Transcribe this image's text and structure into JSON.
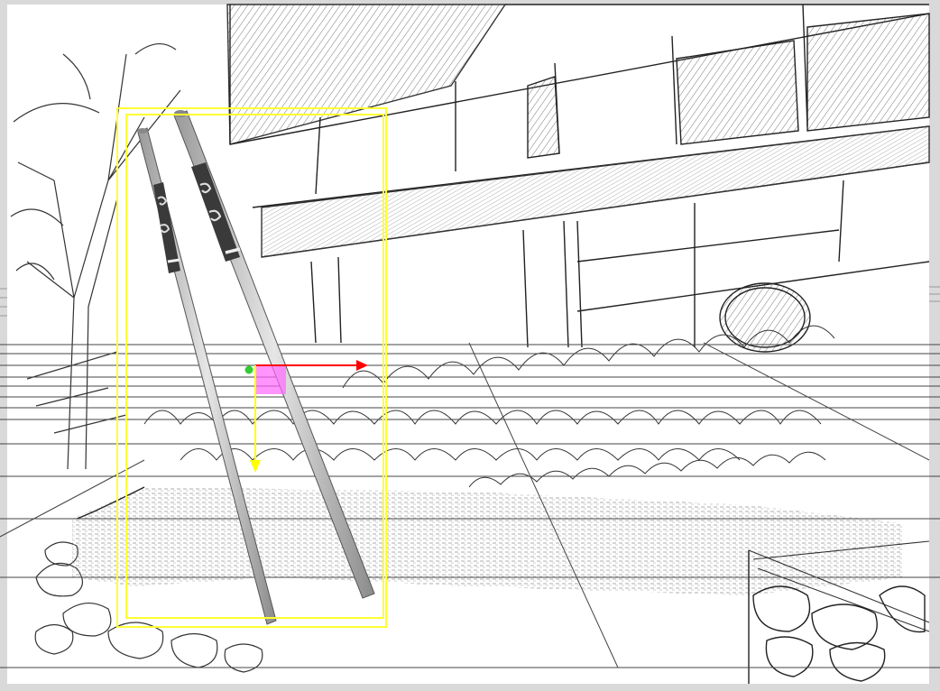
{
  "canvas": {
    "name": "sketch-canvas",
    "background": "#ffffff",
    "frame_color": "#d9d9d9"
  },
  "selection": {
    "tool": "move-transform",
    "bbox_color": "#ffff33",
    "gizmo": {
      "x_axis_color": "#ff0000",
      "y_axis_color": "#ffff00",
      "plane_handle_color": "#ff66ff",
      "origin_color": "#33cc33"
    }
  },
  "objects": [
    {
      "name": "chopstick-left",
      "pattern_label": "S"
    },
    {
      "name": "chopstick-right",
      "pattern_label": "S"
    }
  ],
  "guides": {
    "perspective_lines_color": "#444444"
  }
}
